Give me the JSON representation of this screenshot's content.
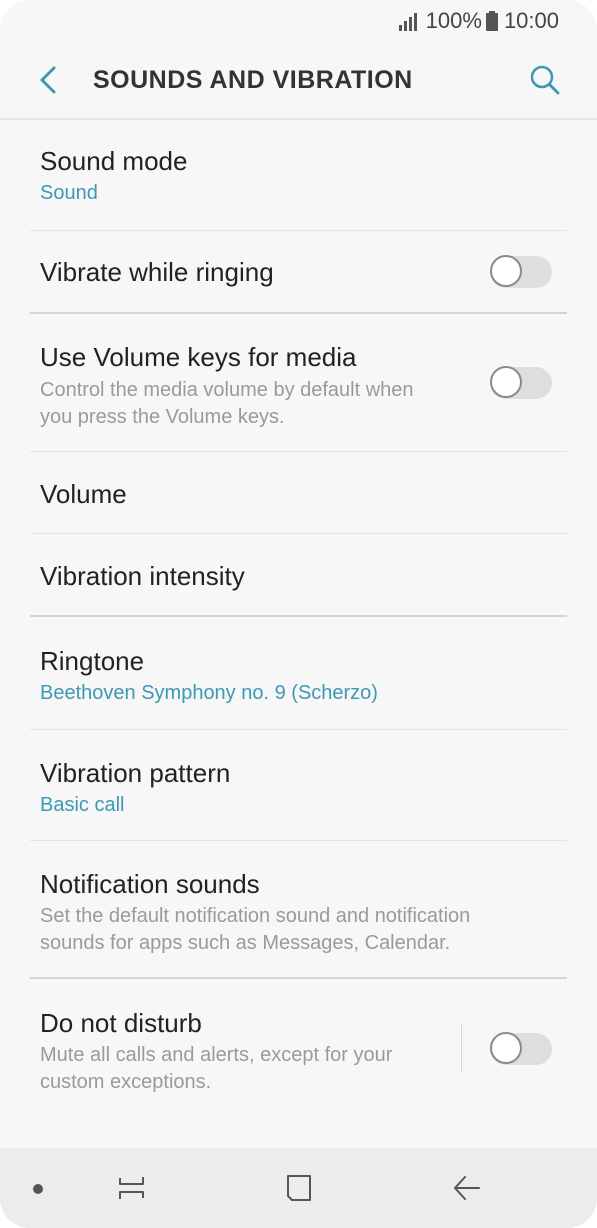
{
  "status_bar": {
    "battery_text": "100%",
    "time": "10:00"
  },
  "app_bar": {
    "title": "SOUNDS AND VIBRATION"
  },
  "items": {
    "sound_mode": {
      "title": "Sound mode",
      "value": "Sound"
    },
    "vibrate_ringing": {
      "title": "Vibrate while ringing",
      "enabled": false
    },
    "volume_keys": {
      "title": "Use Volume keys for media",
      "description": "Control the media volume by default when you press the Volume keys.",
      "enabled": false
    },
    "volume": {
      "title": "Volume"
    },
    "vibration_intensity": {
      "title": "Vibration intensity"
    },
    "ringtone": {
      "title": "Ringtone",
      "value": "Beethoven Symphony no. 9 (Scherzo)"
    },
    "vibration_pattern": {
      "title": "Vibration pattern",
      "value": "Basic call"
    },
    "notification_sounds": {
      "title": "Notification sounds",
      "description": "Set the default notification sound and notification sounds for apps such as Messages, Calendar."
    },
    "do_not_disturb": {
      "title": "Do not disturb",
      "description": "Mute all calls and alerts, except for your custom exceptions.",
      "enabled": false
    }
  },
  "colors": {
    "accent": "#3d98b4",
    "background": "#f7f7f7",
    "nav_bar": "#ececec"
  }
}
